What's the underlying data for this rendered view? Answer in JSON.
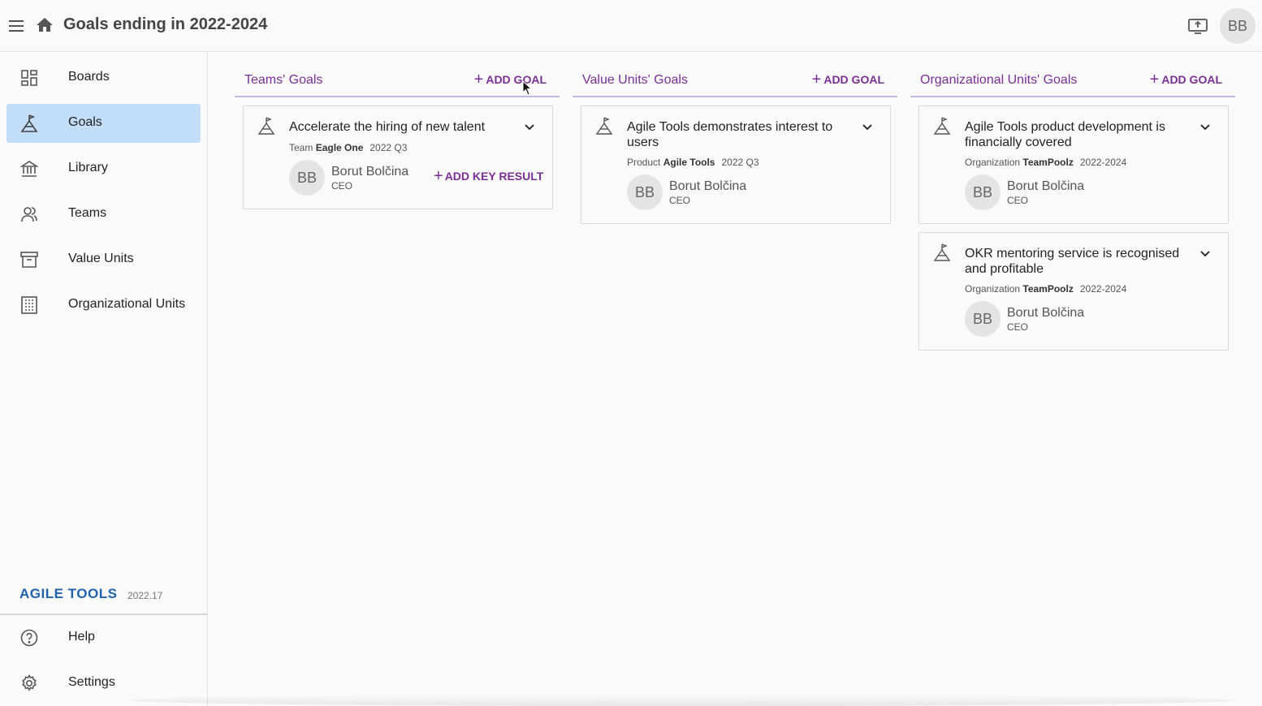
{
  "header": {
    "title": "Goals ending in 2022-2024",
    "user_initials": "BB",
    "icons": [
      "menu-icon",
      "home-icon",
      "present-to-all-icon"
    ]
  },
  "sidebar": {
    "items": [
      {
        "label": "Boards",
        "icon": "dashboard-icon"
      },
      {
        "label": "Goals",
        "icon": "goal-flag-icon",
        "active": true
      },
      {
        "label": "Library",
        "icon": "library-icon"
      },
      {
        "label": "Teams",
        "icon": "team-icon"
      },
      {
        "label": "Value Units",
        "icon": "archive-box-icon"
      },
      {
        "label": "Organizational Units",
        "icon": "building-icon"
      }
    ],
    "brand": {
      "name": "AGILE TOOLS",
      "version": "2022.17"
    },
    "footer_items": [
      {
        "label": "Help",
        "icon": "help-icon"
      },
      {
        "label": "Settings",
        "icon": "gear-icon"
      }
    ]
  },
  "columns": [
    {
      "title": "Teams' Goals",
      "add_label": "ADD GOAL",
      "goals": [
        {
          "title": "Accelerate the hiring of new talent",
          "unit_type": "Team",
          "unit_name": "Eagle One",
          "period": "2022 Q3",
          "owner_initials": "BB",
          "owner_name": "Borut Bolčina",
          "owner_role": "CEO",
          "add_key_result_label": "ADD KEY RESULT"
        }
      ]
    },
    {
      "title": "Value Units' Goals",
      "add_label": "ADD GOAL",
      "goals": [
        {
          "title": "Agile Tools demonstrates interest to users",
          "unit_type": "Product",
          "unit_name": "Agile Tools",
          "period": "2022 Q3",
          "owner_initials": "BB",
          "owner_name": "Borut Bolčina",
          "owner_role": "CEO"
        }
      ]
    },
    {
      "title": "Organizational Units' Goals",
      "add_label": "ADD GOAL",
      "goals": [
        {
          "title": "Agile Tools product development is financially covered",
          "unit_type": "Organization",
          "unit_name": "TeamPoolz",
          "period": "2022-2024",
          "owner_initials": "BB",
          "owner_name": "Borut Bolčina",
          "owner_role": "CEO"
        },
        {
          "title": "OKR mentoring service is recognised and profitable",
          "unit_type": "Organization",
          "unit_name": "TeamPoolz",
          "period": "2022-2024",
          "owner_initials": "BB",
          "owner_name": "Borut Bolčina",
          "owner_role": "CEO"
        }
      ]
    }
  ],
  "colors": {
    "accent": "#7b2f96",
    "active_nav": "#c2ddf7",
    "brand": "#1f63ad"
  }
}
